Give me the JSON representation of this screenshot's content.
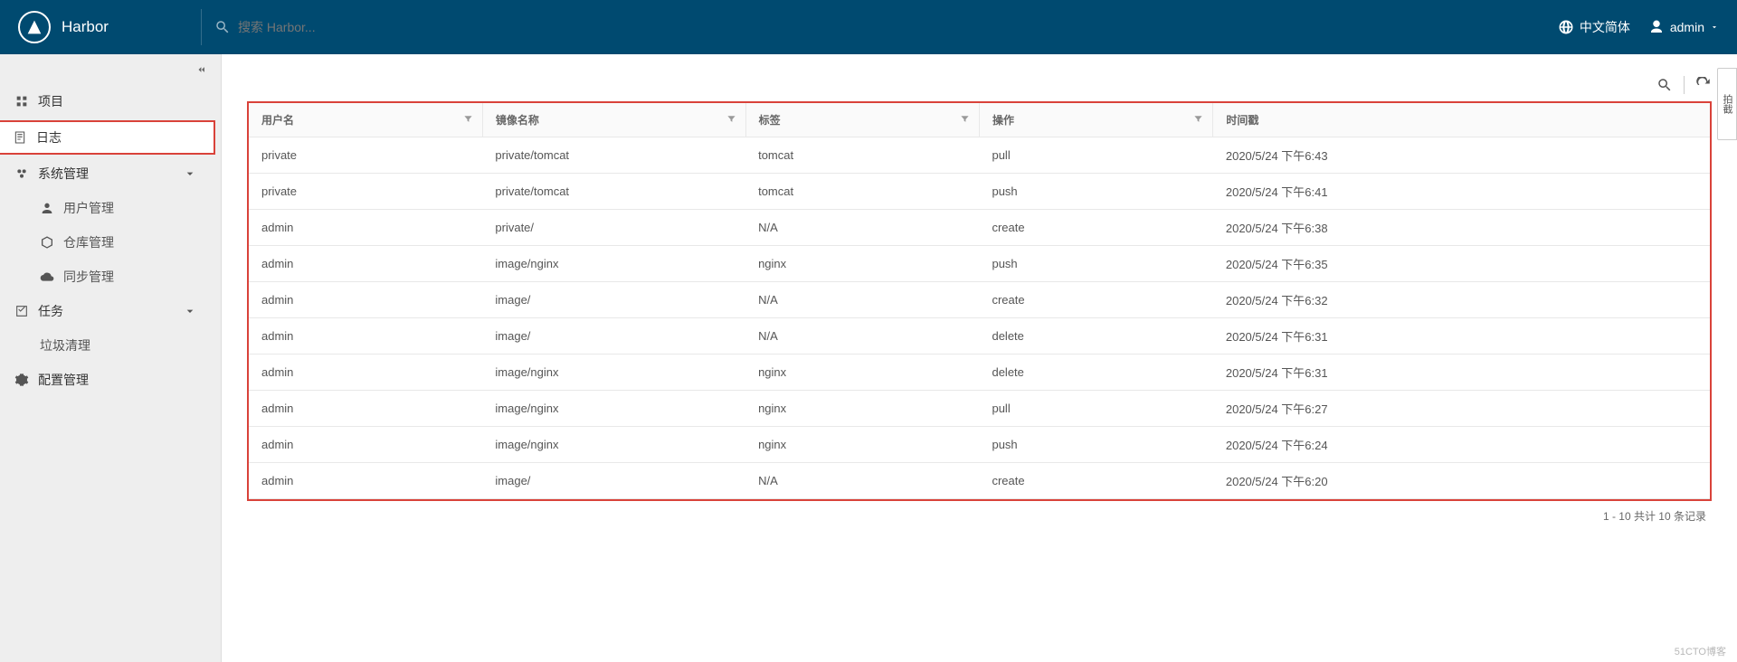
{
  "app": {
    "name": "Harbor"
  },
  "search": {
    "placeholder": "搜索 Harbor..."
  },
  "header": {
    "language": "中文简体",
    "user": "admin"
  },
  "sidebar": {
    "projects": "项目",
    "logs": "日志",
    "system": "系统管理",
    "users": "用户管理",
    "repos": "仓库管理",
    "replication": "同步管理",
    "tasks": "任务",
    "gc": "垃圾清理",
    "config": "配置管理"
  },
  "table": {
    "columns": {
      "user": "用户名",
      "image": "镜像名称",
      "tag": "标签",
      "operation": "操作",
      "timestamp": "时间戳"
    },
    "rows": [
      {
        "user": "private",
        "image": "private/tomcat",
        "tag": "tomcat",
        "op": "pull",
        "ts": "2020/5/24 下午6:43"
      },
      {
        "user": "private",
        "image": "private/tomcat",
        "tag": "tomcat",
        "op": "push",
        "ts": "2020/5/24 下午6:41"
      },
      {
        "user": "admin",
        "image": "private/",
        "tag": "N/A",
        "op": "create",
        "ts": "2020/5/24 下午6:38"
      },
      {
        "user": "admin",
        "image": "image/nginx",
        "tag": "nginx",
        "op": "push",
        "ts": "2020/5/24 下午6:35"
      },
      {
        "user": "admin",
        "image": "image/",
        "tag": "N/A",
        "op": "create",
        "ts": "2020/5/24 下午6:32"
      },
      {
        "user": "admin",
        "image": "image/",
        "tag": "N/A",
        "op": "delete",
        "ts": "2020/5/24 下午6:31"
      },
      {
        "user": "admin",
        "image": "image/nginx",
        "tag": "nginx",
        "op": "delete",
        "ts": "2020/5/24 下午6:31"
      },
      {
        "user": "admin",
        "image": "image/nginx",
        "tag": "nginx",
        "op": "pull",
        "ts": "2020/5/24 下午6:27"
      },
      {
        "user": "admin",
        "image": "image/nginx",
        "tag": "nginx",
        "op": "push",
        "ts": "2020/5/24 下午6:24"
      },
      {
        "user": "admin",
        "image": "image/",
        "tag": "N/A",
        "op": "create",
        "ts": "2020/5/24 下午6:20"
      }
    ],
    "pager": "1 - 10 共计 10 条记录"
  },
  "watermark": "51CTO博客",
  "sidetab": "拍截"
}
